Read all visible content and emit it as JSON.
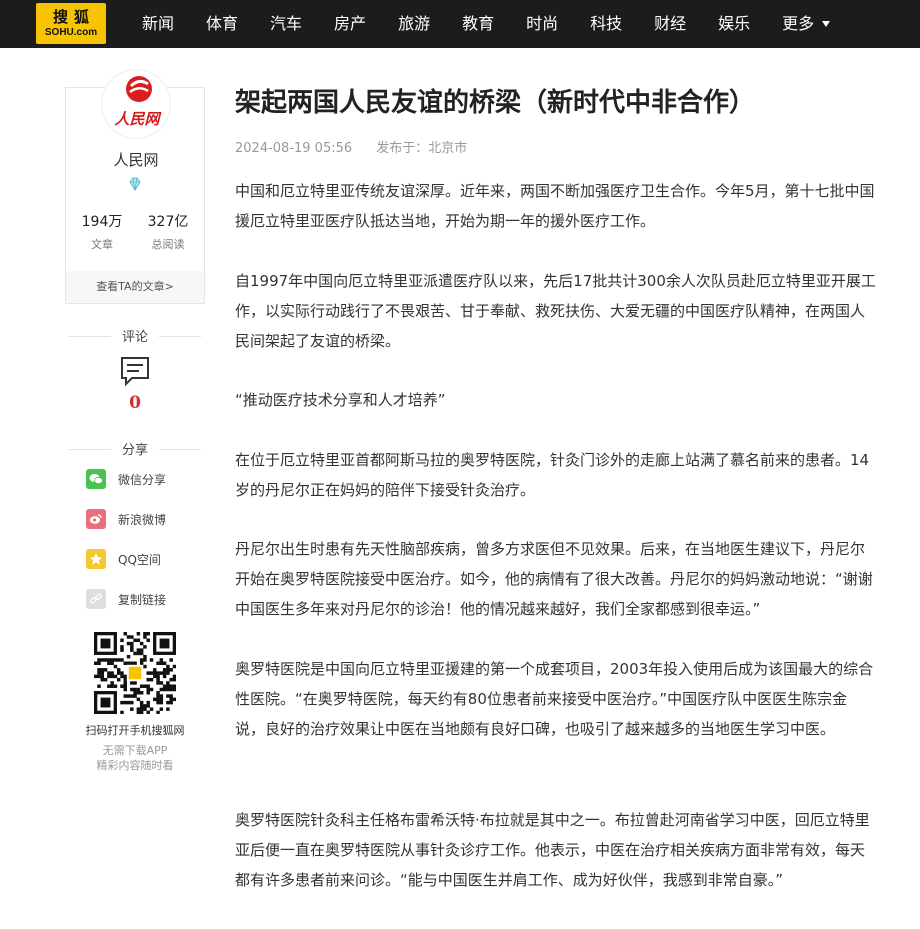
{
  "header": {
    "logo_cn": "搜狐",
    "logo_en": "SOHU.com",
    "nav": [
      "新闻",
      "体育",
      "汽车",
      "房产",
      "旅游",
      "教育",
      "时尚",
      "科技",
      "财经",
      "娱乐"
    ],
    "more": "更多"
  },
  "author": {
    "avatar_text": "人民网",
    "name": "人民网",
    "articles_count": "194万",
    "articles_label": "文章",
    "reads_count": "327亿",
    "reads_label": "总阅读",
    "view_articles": "查看TA的文章>"
  },
  "comments": {
    "title": "评论",
    "count": "0"
  },
  "share": {
    "title": "分享",
    "wechat": "微信分享",
    "weibo": "新浪微博",
    "qzone": "QQ空间",
    "copy_link": "复制链接"
  },
  "qr": {
    "title": "扫码打开手机搜狐网",
    "line1": "无需下载APP",
    "line2": "精彩内容随时看"
  },
  "article": {
    "title": "架起两国人民友谊的桥梁（新时代中非合作）",
    "date": "2024-08-19 05:56",
    "published_from": "发布于：北京市",
    "paragraphs": [
      "中国和厄立特里亚传统友谊深厚。近年来，两国不断加强医疗卫生合作。今年5月，第十七批中国援厄立特里亚医疗队抵达当地，开始为期一年的援外医疗工作。",
      "自1997年中国向厄立特里亚派遣医疗队以来，先后17批共计300余人次队员赴厄立特里亚开展工作，以实际行动践行了不畏艰苦、甘于奉献、救死扶伤、大爱无疆的中国医疗队精神，在两国人民间架起了友谊的桥梁。",
      "“推动医疗技术分享和人才培养”",
      "在位于厄立特里亚首都阿斯马拉的奥罗特医院，针灸门诊外的走廊上站满了慕名前来的患者。14岁的丹尼尔正在妈妈的陪伴下接受针灸治疗。",
      "丹尼尔出生时患有先天性脑部疾病，曾多方求医但不见效果。后来，在当地医生建议下，丹尼尔开始在奥罗特医院接受中医治疗。如今，他的病情有了很大改善。丹尼尔的妈妈激动地说：“谢谢中国医生多年来对丹尼尔的诊治！他的情况越来越好，我们全家都感到很幸运。”",
      "奥罗特医院是中国向厄立特里亚援建的第一个成套项目，2003年投入使用后成为该国最大的综合性医院。“在奥罗特医院，每天约有80位患者前来接受中医治疗。”中国医疗队中医医生陈宗金说，良好的治疗效果让中医在当地颇有良好口碑，也吸引了越来越多的当地医生学习中医。",
      "奥罗特医院针灸科主任格布雷希沃特·布拉就是其中之一。布拉曾赴河南省学习中医，回厄立特里亚后便一直在奥罗特医院从事针灸诊疗工作。他表示，中医在治疗相关疾病方面非常有效，每天都有许多患者前来问诊。“能与中国医生并肩工作、成为好伙伴，我感到非常自豪。”"
    ]
  }
}
